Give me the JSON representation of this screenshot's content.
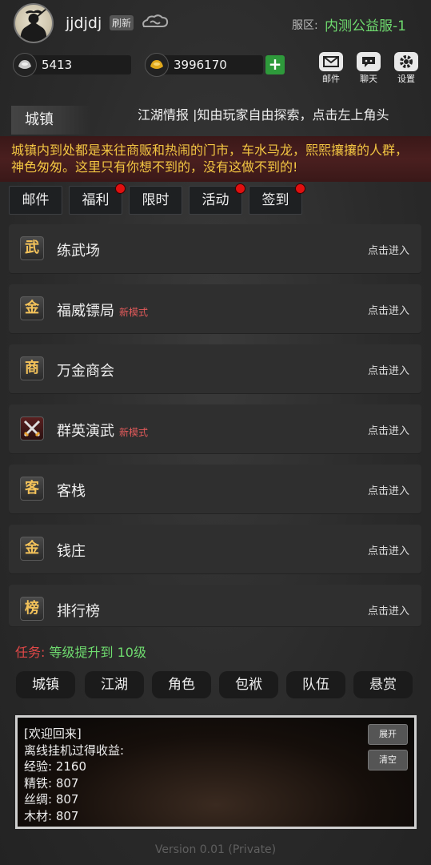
{
  "header": {
    "username": "jjdjdj",
    "refresh_label": "刷新",
    "server_label": "服区:",
    "server_name": "内测公益服-1"
  },
  "currency": {
    "silver": "5413",
    "gold": "3996170",
    "plus": "+"
  },
  "top_buttons": [
    {
      "label": "邮件",
      "icon": "mail-icon"
    },
    {
      "label": "聊天",
      "icon": "chat-icon"
    },
    {
      "label": "设置",
      "icon": "gear-icon"
    }
  ],
  "section": {
    "title": "城镇",
    "news": "江湖情报 |知由玩家自由探索，点击左上角头",
    "description": "城镇内到处都是来往商贩和热闹的门市，车水马龙，熙熙攘攘的人群，神色匆匆。这里只有你想不到的，没有这做不到的!"
  },
  "tabs": [
    {
      "label": "邮件",
      "dot": false
    },
    {
      "label": "福利",
      "dot": true
    },
    {
      "label": "限时",
      "dot": false
    },
    {
      "label": "活动",
      "dot": true
    },
    {
      "label": "签到",
      "dot": true
    }
  ],
  "locations": [
    {
      "badge": "武",
      "name": "练武场",
      "tag": "",
      "enter": "点击进入"
    },
    {
      "badge": "金",
      "name": "福威镖局",
      "tag": "新模式",
      "enter": "点击进入"
    },
    {
      "badge": "商",
      "name": "万金商会",
      "tag": "",
      "enter": "点击进入"
    },
    {
      "badge": "swords-icon",
      "name": "群英演武",
      "tag": "新模式",
      "enter": "点击进入"
    },
    {
      "badge": "客",
      "name": "客栈",
      "tag": "",
      "enter": "点击进入"
    },
    {
      "badge": "金",
      "name": "钱庄",
      "tag": "",
      "enter": "点击进入"
    },
    {
      "badge": "榜",
      "name": "排行榜",
      "tag": "",
      "enter": "点击进入"
    }
  ],
  "task": {
    "label": "任务:",
    "text": "等级提升到 10级"
  },
  "nav": [
    "城镇",
    "江湖",
    "角色",
    "包袱",
    "队伍",
    "悬赏"
  ],
  "log": {
    "lines": [
      "[欢迎回来]",
      "离线挂机过得收益:",
      "经验:  2160",
      "精铁:  807",
      "丝绸:  807",
      "木材:  807"
    ],
    "expand_label": "展开",
    "clear_label": "清空"
  },
  "version": "Version 0.01 (Private)",
  "colors": {
    "server_green": "#6fdc6f",
    "description_gold": "#f2c542",
    "new_tag_red": "#e25a5a",
    "task_red": "#e34848",
    "notify_dot": "#e01010",
    "plus_green": "#2e9a3b"
  }
}
